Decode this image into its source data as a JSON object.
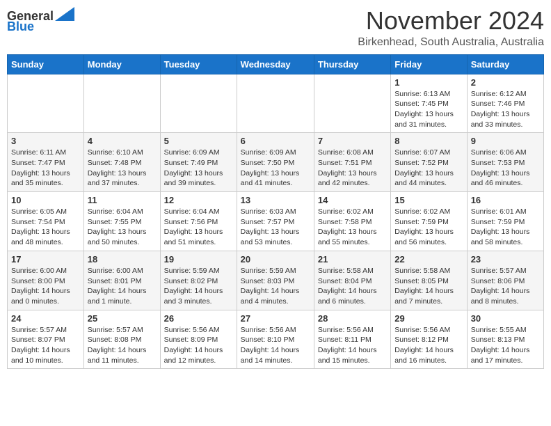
{
  "header": {
    "logo_line1": "General",
    "logo_line2": "Blue",
    "month": "November 2024",
    "location": "Birkenhead, South Australia, Australia"
  },
  "weekdays": [
    "Sunday",
    "Monday",
    "Tuesday",
    "Wednesday",
    "Thursday",
    "Friday",
    "Saturday"
  ],
  "weeks": [
    [
      {
        "day": "",
        "info": ""
      },
      {
        "day": "",
        "info": ""
      },
      {
        "day": "",
        "info": ""
      },
      {
        "day": "",
        "info": ""
      },
      {
        "day": "",
        "info": ""
      },
      {
        "day": "1",
        "info": "Sunrise: 6:13 AM\nSunset: 7:45 PM\nDaylight: 13 hours\nand 31 minutes."
      },
      {
        "day": "2",
        "info": "Sunrise: 6:12 AM\nSunset: 7:46 PM\nDaylight: 13 hours\nand 33 minutes."
      }
    ],
    [
      {
        "day": "3",
        "info": "Sunrise: 6:11 AM\nSunset: 7:47 PM\nDaylight: 13 hours\nand 35 minutes."
      },
      {
        "day": "4",
        "info": "Sunrise: 6:10 AM\nSunset: 7:48 PM\nDaylight: 13 hours\nand 37 minutes."
      },
      {
        "day": "5",
        "info": "Sunrise: 6:09 AM\nSunset: 7:49 PM\nDaylight: 13 hours\nand 39 minutes."
      },
      {
        "day": "6",
        "info": "Sunrise: 6:09 AM\nSunset: 7:50 PM\nDaylight: 13 hours\nand 41 minutes."
      },
      {
        "day": "7",
        "info": "Sunrise: 6:08 AM\nSunset: 7:51 PM\nDaylight: 13 hours\nand 42 minutes."
      },
      {
        "day": "8",
        "info": "Sunrise: 6:07 AM\nSunset: 7:52 PM\nDaylight: 13 hours\nand 44 minutes."
      },
      {
        "day": "9",
        "info": "Sunrise: 6:06 AM\nSunset: 7:53 PM\nDaylight: 13 hours\nand 46 minutes."
      }
    ],
    [
      {
        "day": "10",
        "info": "Sunrise: 6:05 AM\nSunset: 7:54 PM\nDaylight: 13 hours\nand 48 minutes."
      },
      {
        "day": "11",
        "info": "Sunrise: 6:04 AM\nSunset: 7:55 PM\nDaylight: 13 hours\nand 50 minutes."
      },
      {
        "day": "12",
        "info": "Sunrise: 6:04 AM\nSunset: 7:56 PM\nDaylight: 13 hours\nand 51 minutes."
      },
      {
        "day": "13",
        "info": "Sunrise: 6:03 AM\nSunset: 7:57 PM\nDaylight: 13 hours\nand 53 minutes."
      },
      {
        "day": "14",
        "info": "Sunrise: 6:02 AM\nSunset: 7:58 PM\nDaylight: 13 hours\nand 55 minutes."
      },
      {
        "day": "15",
        "info": "Sunrise: 6:02 AM\nSunset: 7:59 PM\nDaylight: 13 hours\nand 56 minutes."
      },
      {
        "day": "16",
        "info": "Sunrise: 6:01 AM\nSunset: 7:59 PM\nDaylight: 13 hours\nand 58 minutes."
      }
    ],
    [
      {
        "day": "17",
        "info": "Sunrise: 6:00 AM\nSunset: 8:00 PM\nDaylight: 14 hours\nand 0 minutes."
      },
      {
        "day": "18",
        "info": "Sunrise: 6:00 AM\nSunset: 8:01 PM\nDaylight: 14 hours\nand 1 minute."
      },
      {
        "day": "19",
        "info": "Sunrise: 5:59 AM\nSunset: 8:02 PM\nDaylight: 14 hours\nand 3 minutes."
      },
      {
        "day": "20",
        "info": "Sunrise: 5:59 AM\nSunset: 8:03 PM\nDaylight: 14 hours\nand 4 minutes."
      },
      {
        "day": "21",
        "info": "Sunrise: 5:58 AM\nSunset: 8:04 PM\nDaylight: 14 hours\nand 6 minutes."
      },
      {
        "day": "22",
        "info": "Sunrise: 5:58 AM\nSunset: 8:05 PM\nDaylight: 14 hours\nand 7 minutes."
      },
      {
        "day": "23",
        "info": "Sunrise: 5:57 AM\nSunset: 8:06 PM\nDaylight: 14 hours\nand 8 minutes."
      }
    ],
    [
      {
        "day": "24",
        "info": "Sunrise: 5:57 AM\nSunset: 8:07 PM\nDaylight: 14 hours\nand 10 minutes."
      },
      {
        "day": "25",
        "info": "Sunrise: 5:57 AM\nSunset: 8:08 PM\nDaylight: 14 hours\nand 11 minutes."
      },
      {
        "day": "26",
        "info": "Sunrise: 5:56 AM\nSunset: 8:09 PM\nDaylight: 14 hours\nand 12 minutes."
      },
      {
        "day": "27",
        "info": "Sunrise: 5:56 AM\nSunset: 8:10 PM\nDaylight: 14 hours\nand 14 minutes."
      },
      {
        "day": "28",
        "info": "Sunrise: 5:56 AM\nSunset: 8:11 PM\nDaylight: 14 hours\nand 15 minutes."
      },
      {
        "day": "29",
        "info": "Sunrise: 5:56 AM\nSunset: 8:12 PM\nDaylight: 14 hours\nand 16 minutes."
      },
      {
        "day": "30",
        "info": "Sunrise: 5:55 AM\nSunset: 8:13 PM\nDaylight: 14 hours\nand 17 minutes."
      }
    ]
  ]
}
